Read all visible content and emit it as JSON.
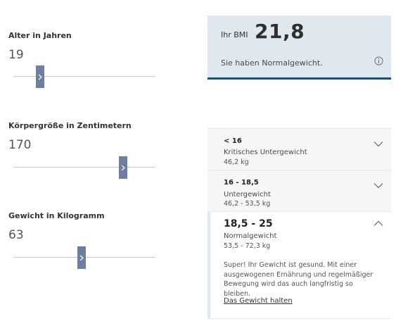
{
  "sliders": [
    {
      "label": "Alter in Jahren",
      "value": "19",
      "fraction": 0.19
    },
    {
      "label": "Körpergröße in Zentimetern",
      "value": "170",
      "fraction": 0.77
    },
    {
      "label": "Gewicht in Kilogramm",
      "value": "63",
      "fraction": 0.46
    }
  ],
  "result": {
    "caption": "Ihr BMI",
    "value": "21,8",
    "status": "Sie haben Normalgewicht.",
    "icon": "info-icon"
  },
  "categories": [
    {
      "range": "< 16",
      "title": "Kritisches Untergewicht",
      "weight": "46,2 kg",
      "expanded": false
    },
    {
      "range": "16 - 18,5",
      "title": "Untergewicht",
      "weight": "46,2 - 53,5 kg",
      "expanded": false
    },
    {
      "range": "18,5 - 25",
      "title": "Normalgewicht",
      "weight": "53,5 - 72,3 kg",
      "expanded": true,
      "text": "Super! Ihr Gewicht ist gesund. Mit einer ausgewogenen Ernährung und regelmäßiger Bewegung wird das auch langfristig so bleiben.",
      "link": "Das Gewicht halten"
    }
  ],
  "colors": {
    "accent": "#1e4e74",
    "thumb": "#6e7ea3",
    "result_bg": "#dfe8ef"
  }
}
